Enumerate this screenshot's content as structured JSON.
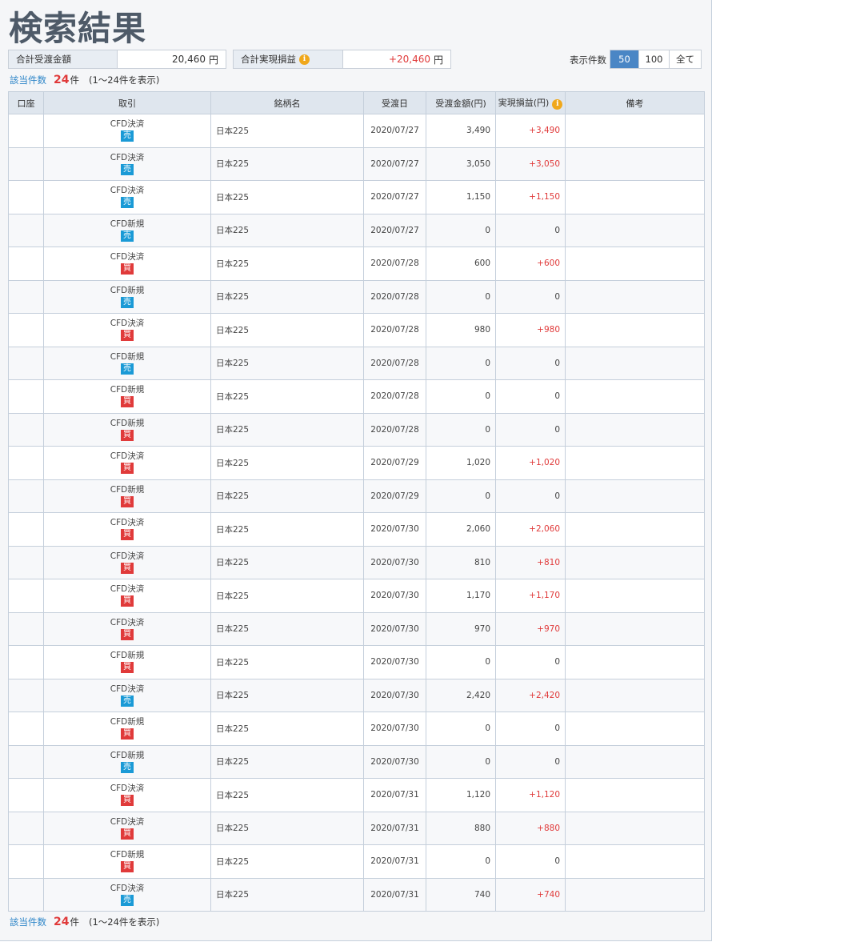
{
  "title": "検索結果",
  "summary": {
    "settlement_label": "合計受渡金額",
    "settlement_value": "20,460",
    "settlement_currency": "円",
    "pnl_label": "合計実現損益",
    "pnl_value": "+20,460",
    "pnl_currency": "円"
  },
  "pager": {
    "label": "表示件数",
    "options": [
      "50",
      "100",
      "全て"
    ],
    "selected": "50"
  },
  "count": {
    "label": "該当件数",
    "number": "24",
    "unit": "件",
    "range": "(1〜24件を表示)"
  },
  "table": {
    "headers": [
      "口座",
      "取引",
      "銘柄名",
      "受渡日",
      "受渡金額(円)",
      "実現損益(円)",
      "備考"
    ],
    "rows": [
      {
        "trade": "CFD決済",
        "side": "売",
        "name": "日本225",
        "date": "2020/07/27",
        "amount": "3,490",
        "pnl": "+3,490"
      },
      {
        "trade": "CFD決済",
        "side": "売",
        "name": "日本225",
        "date": "2020/07/27",
        "amount": "3,050",
        "pnl": "+3,050"
      },
      {
        "trade": "CFD決済",
        "side": "売",
        "name": "日本225",
        "date": "2020/07/27",
        "amount": "1,150",
        "pnl": "+1,150"
      },
      {
        "trade": "CFD新規",
        "side": "売",
        "name": "日本225",
        "date": "2020/07/27",
        "amount": "0",
        "pnl": "0"
      },
      {
        "trade": "CFD決済",
        "side": "買",
        "name": "日本225",
        "date": "2020/07/28",
        "amount": "600",
        "pnl": "+600"
      },
      {
        "trade": "CFD新規",
        "side": "売",
        "name": "日本225",
        "date": "2020/07/28",
        "amount": "0",
        "pnl": "0"
      },
      {
        "trade": "CFD決済",
        "side": "買",
        "name": "日本225",
        "date": "2020/07/28",
        "amount": "980",
        "pnl": "+980"
      },
      {
        "trade": "CFD新規",
        "side": "売",
        "name": "日本225",
        "date": "2020/07/28",
        "amount": "0",
        "pnl": "0"
      },
      {
        "trade": "CFD新規",
        "side": "買",
        "name": "日本225",
        "date": "2020/07/28",
        "amount": "0",
        "pnl": "0"
      },
      {
        "trade": "CFD新規",
        "side": "買",
        "name": "日本225",
        "date": "2020/07/28",
        "amount": "0",
        "pnl": "0"
      },
      {
        "trade": "CFD決済",
        "side": "買",
        "name": "日本225",
        "date": "2020/07/29",
        "amount": "1,020",
        "pnl": "+1,020"
      },
      {
        "trade": "CFD新規",
        "side": "買",
        "name": "日本225",
        "date": "2020/07/29",
        "amount": "0",
        "pnl": "0"
      },
      {
        "trade": "CFD決済",
        "side": "買",
        "name": "日本225",
        "date": "2020/07/30",
        "amount": "2,060",
        "pnl": "+2,060"
      },
      {
        "trade": "CFD決済",
        "side": "買",
        "name": "日本225",
        "date": "2020/07/30",
        "amount": "810",
        "pnl": "+810"
      },
      {
        "trade": "CFD決済",
        "side": "買",
        "name": "日本225",
        "date": "2020/07/30",
        "amount": "1,170",
        "pnl": "+1,170"
      },
      {
        "trade": "CFD決済",
        "side": "買",
        "name": "日本225",
        "date": "2020/07/30",
        "amount": "970",
        "pnl": "+970"
      },
      {
        "trade": "CFD新規",
        "side": "買",
        "name": "日本225",
        "date": "2020/07/30",
        "amount": "0",
        "pnl": "0"
      },
      {
        "trade": "CFD決済",
        "side": "売",
        "name": "日本225",
        "date": "2020/07/30",
        "amount": "2,420",
        "pnl": "+2,420"
      },
      {
        "trade": "CFD新規",
        "side": "買",
        "name": "日本225",
        "date": "2020/07/30",
        "amount": "0",
        "pnl": "0"
      },
      {
        "trade": "CFD新規",
        "side": "売",
        "name": "日本225",
        "date": "2020/07/30",
        "amount": "0",
        "pnl": "0"
      },
      {
        "trade": "CFD決済",
        "side": "買",
        "name": "日本225",
        "date": "2020/07/31",
        "amount": "1,120",
        "pnl": "+1,120"
      },
      {
        "trade": "CFD決済",
        "side": "買",
        "name": "日本225",
        "date": "2020/07/31",
        "amount": "880",
        "pnl": "+880"
      },
      {
        "trade": "CFD新規",
        "side": "買",
        "name": "日本225",
        "date": "2020/07/31",
        "amount": "0",
        "pnl": "0"
      },
      {
        "trade": "CFD決済",
        "side": "売",
        "name": "日本225",
        "date": "2020/07/31",
        "amount": "740",
        "pnl": "+740"
      }
    ]
  },
  "colors": {
    "sell_badge": "#1a9ad6",
    "buy_badge": "#e03a3a",
    "positive": "#e03a3a",
    "accent": "#4a86c5",
    "header_bg": "#dfe6ee"
  }
}
